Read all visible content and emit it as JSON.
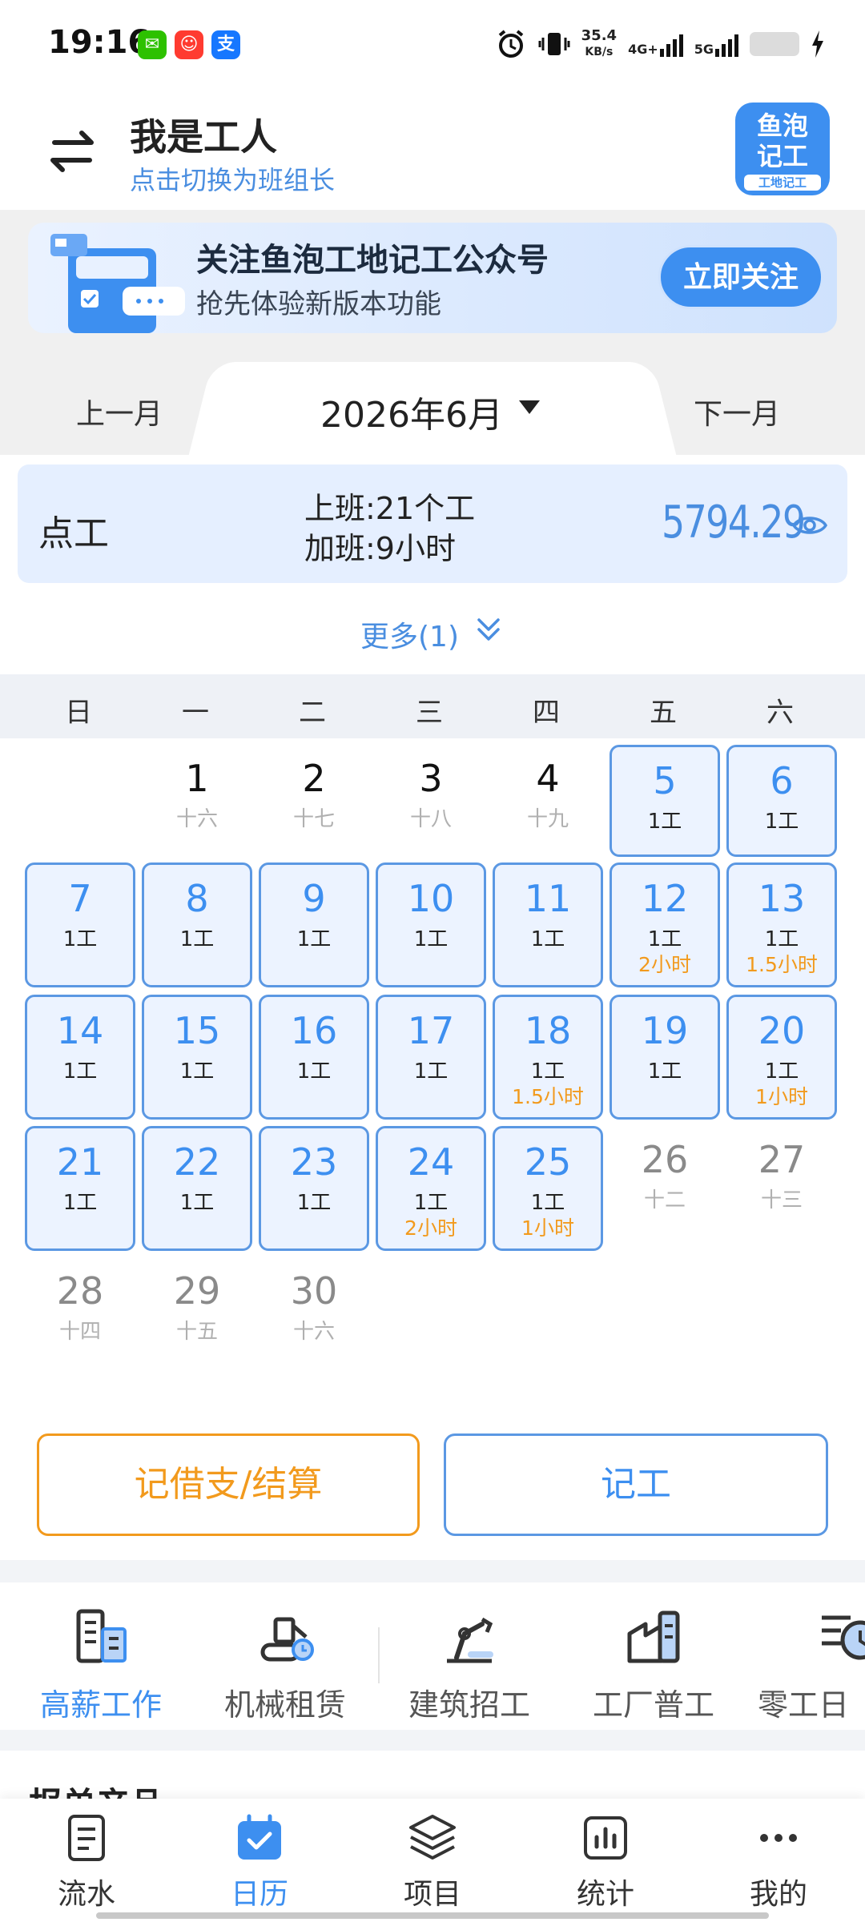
{
  "status_bar": {
    "time": "19:16",
    "app_icons": [
      {
        "name": "wechat-icon",
        "glyph": "✉",
        "color": "#2dc100"
      },
      {
        "name": "taobao-icon",
        "glyph": "☺",
        "color": "#ff3b30"
      },
      {
        "name": "alipay-icon",
        "glyph": "支",
        "color": "#1677ff"
      }
    ],
    "speed_value": "35.4",
    "speed_unit": "KB/s",
    "net_a": "4G+",
    "net_b": "5G"
  },
  "header": {
    "role_title": "我是工人",
    "switch_hint": "点击切换为班组长",
    "logo_line1": "鱼泡",
    "logo_line2": "记工",
    "logo_sub": "工地记工"
  },
  "banner": {
    "title": "关注鱼泡工地记工公众号",
    "subtitle": "抢先体验新版本功能",
    "button": "立即关注"
  },
  "month_nav": {
    "prev": "上一月",
    "current": "2026年6月",
    "next": "下一月"
  },
  "summary": {
    "type": "点工",
    "work_line": "上班:21个工",
    "overtime_line": "加班:9小时",
    "amount": "5794.29"
  },
  "more_link": "更多(1)",
  "weekdays": [
    "日",
    "一",
    "二",
    "三",
    "四",
    "五",
    "六"
  ],
  "calendar": [
    {
      "day": "1",
      "lunar": "十六",
      "work": "",
      "ot": ""
    },
    {
      "day": "2",
      "lunar": "十七",
      "work": "",
      "ot": ""
    },
    {
      "day": "3",
      "lunar": "十八",
      "work": "",
      "ot": ""
    },
    {
      "day": "4",
      "lunar": "十九",
      "work": "",
      "ot": ""
    },
    {
      "day": "5",
      "lunar": "",
      "work": "1工",
      "ot": ""
    },
    {
      "day": "6",
      "lunar": "",
      "work": "1工",
      "ot": ""
    },
    {
      "day": "7",
      "lunar": "",
      "work": "1工",
      "ot": ""
    },
    {
      "day": "8",
      "lunar": "",
      "work": "1工",
      "ot": ""
    },
    {
      "day": "9",
      "lunar": "",
      "work": "1工",
      "ot": ""
    },
    {
      "day": "10",
      "lunar": "",
      "work": "1工",
      "ot": ""
    },
    {
      "day": "11",
      "lunar": "",
      "work": "1工",
      "ot": ""
    },
    {
      "day": "12",
      "lunar": "",
      "work": "1工",
      "ot": "2小时"
    },
    {
      "day": "13",
      "lunar": "",
      "work": "1工",
      "ot": "1.5小时"
    },
    {
      "day": "14",
      "lunar": "",
      "work": "1工",
      "ot": ""
    },
    {
      "day": "15",
      "lunar": "",
      "work": "1工",
      "ot": ""
    },
    {
      "day": "16",
      "lunar": "",
      "work": "1工",
      "ot": ""
    },
    {
      "day": "17",
      "lunar": "",
      "work": "1工",
      "ot": ""
    },
    {
      "day": "18",
      "lunar": "",
      "work": "1工",
      "ot": "1.5小时"
    },
    {
      "day": "19",
      "lunar": "",
      "work": "1工",
      "ot": ""
    },
    {
      "day": "20",
      "lunar": "",
      "work": "1工",
      "ot": "1小时"
    },
    {
      "day": "21",
      "lunar": "",
      "work": "1工",
      "ot": ""
    },
    {
      "day": "22",
      "lunar": "",
      "work": "1工",
      "ot": ""
    },
    {
      "day": "23",
      "lunar": "",
      "work": "1工",
      "ot": ""
    },
    {
      "day": "24",
      "lunar": "",
      "work": "1工",
      "ot": "2小时"
    },
    {
      "day": "25",
      "lunar": "",
      "work": "1工",
      "ot": "1小时"
    },
    {
      "day": "26",
      "lunar": "十二",
      "work": "",
      "ot": ""
    },
    {
      "day": "27",
      "lunar": "十三",
      "work": "",
      "ot": ""
    },
    {
      "day": "28",
      "lunar": "十四",
      "work": "",
      "ot": ""
    },
    {
      "day": "29",
      "lunar": "十五",
      "work": "",
      "ot": ""
    },
    {
      "day": "30",
      "lunar": "十六",
      "work": "",
      "ot": ""
    }
  ],
  "actions": {
    "settle": "记借支/结算",
    "record": "记工"
  },
  "services": [
    {
      "label": "高薪工作",
      "icon": "building-icon",
      "active": true
    },
    {
      "label": "机械租赁",
      "icon": "excavator-icon",
      "active": false
    },
    {
      "label": "建筑招工",
      "icon": "robot-arm-icon",
      "active": false
    },
    {
      "label": "工厂普工",
      "icon": "factory-icon",
      "active": false
    },
    {
      "label": "零工日",
      "icon": "clock-icon",
      "active": false
    }
  ],
  "partial_heading": "报单产品",
  "bottom_nav": [
    {
      "label": "流水",
      "icon": "document-icon",
      "active": false
    },
    {
      "label": "日历",
      "icon": "calendar-icon",
      "active": true
    },
    {
      "label": "项目",
      "icon": "layers-icon",
      "active": false
    },
    {
      "label": "统计",
      "icon": "chart-icon",
      "active": false
    },
    {
      "label": "我的",
      "icon": "more-icon",
      "active": false
    }
  ],
  "colors": {
    "accent": "#3d8ff0",
    "overtime": "#f29a1d",
    "record_border": "#5b98e3",
    "record_fill": "#ecf3ff"
  }
}
